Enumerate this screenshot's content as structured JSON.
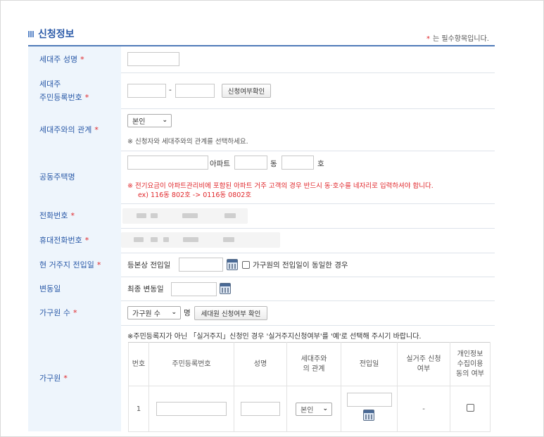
{
  "section_title": "신청정보",
  "required_note": "는 필수항목입니다.",
  "required_mark": "*",
  "fields": {
    "householder_name": {
      "label": "세대주 성명",
      "value": ""
    },
    "householder_rrn": {
      "label_line1": "세대주",
      "label_line2": "주민등록번호",
      "part1": "",
      "part2": "",
      "separator": "-",
      "check_button": "신청여부확인"
    },
    "relation": {
      "label": "세대주와의 관계",
      "selected": "본인",
      "note": "※ 신청자와 세대주와의 관계를 선택하세요."
    },
    "apartment": {
      "label": "공동주택명",
      "name_value": "",
      "suffix_apt": "아파트",
      "dong_value": "",
      "suffix_dong": "동",
      "ho_value": "",
      "suffix_ho": "호",
      "note_red": "※ 전기요금이 아파트관리비에 포함된 아파트 거주 고객의 경우 반드시 동·호수를 네자리로 입력하셔야 합니다.",
      "note_example": "ex) 116동 802호 -> 0116동 0802호"
    },
    "phone": {
      "label": "전화번호"
    },
    "mobile": {
      "label": "휴대전화번호"
    },
    "move_in_date": {
      "label": "현 거주지 전입일",
      "prefix": "등본상 전입일",
      "value": "",
      "checkbox_label": "가구원의 전입일이 동일한 경우"
    },
    "change_date": {
      "label": "변동일",
      "prefix": "최종 변동일",
      "value": ""
    },
    "member_count": {
      "label": "가구원 수",
      "selected": "가구원 수",
      "suffix": "명",
      "button": "세대원 신청여부 확인"
    },
    "members": {
      "label": "가구원",
      "note": "※주민등록지가 아닌 「실거주지」신청인 경우 '실거주지신청여부'를 '예'로 선택해 주시기 바랍니다.",
      "columns": [
        "번호",
        "주민등록번호",
        "성명",
        "세대주와\n의 관계",
        "전입일",
        "실거주 신청\n여부",
        "개인정보\n수집이용\n동의 여부"
      ],
      "rows": [
        {
          "no": "1",
          "rrn": "",
          "name": "",
          "relation": "본인",
          "move_in": "",
          "real_residence": "-"
        }
      ]
    }
  }
}
